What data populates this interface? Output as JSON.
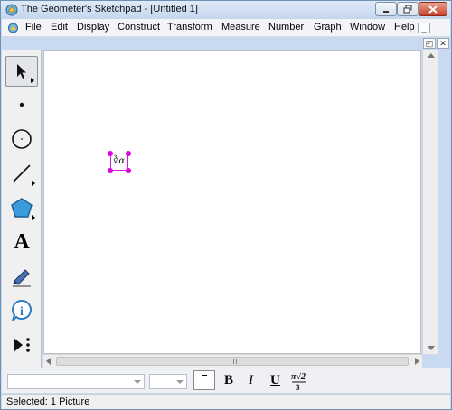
{
  "window": {
    "title": "The Geometer's Sketchpad - [Untitled 1]"
  },
  "menubar": {
    "items": [
      "File",
      "Edit",
      "Display",
      "Construct",
      "Transform",
      "Measure",
      "Number",
      "Graph",
      "Window",
      "Help"
    ]
  },
  "toolbox": {
    "tools": [
      {
        "name": "arrow-tool",
        "icon": "arrow-pointer-icon",
        "active": true
      },
      {
        "name": "point-tool",
        "icon": "point-icon"
      },
      {
        "name": "compass-tool",
        "icon": "circle-icon"
      },
      {
        "name": "straightedge-tool",
        "icon": "line-segment-icon"
      },
      {
        "name": "polygon-tool",
        "icon": "pentagon-icon"
      },
      {
        "name": "text-tool",
        "icon": "text-a-icon",
        "glyph": "A"
      },
      {
        "name": "marker-tool",
        "icon": "marker-pen-icon"
      },
      {
        "name": "information-tool",
        "icon": "info-icon",
        "glyph": "i"
      },
      {
        "name": "custom-tool",
        "icon": "play-more-icon"
      }
    ]
  },
  "canvas": {
    "selected_object": {
      "type": "Picture",
      "glyph": "∛α"
    }
  },
  "formatbar": {
    "font_value": "",
    "size_value": "",
    "bold_label": "B",
    "italic_label": "I",
    "underline_label": "U",
    "math_format_label": "math-format-icon",
    "math_denominator": "3"
  },
  "status": {
    "text": "Selected: 1 Picture"
  },
  "colors": {
    "selection": "#e000e0",
    "polygon_fill": "#3b9ad9",
    "info_icon": "#2a7ec1"
  }
}
